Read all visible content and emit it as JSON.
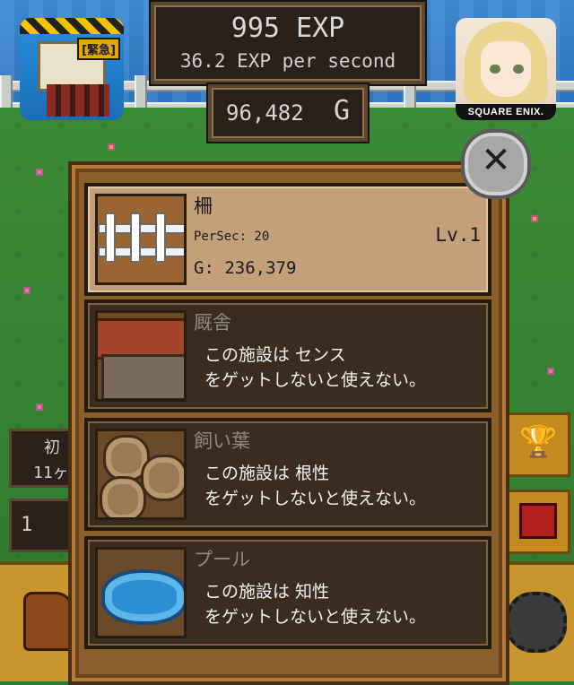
{
  "hud": {
    "exp_value": "995 EXP",
    "exp_rate": "36.2 EXP per second",
    "gold_value": "96,482",
    "gold_unit": "G"
  },
  "ads": {
    "left_badge": "[緊急]",
    "right_brand": "SQUARE ENIX."
  },
  "background_hints": {
    "left_label_top": "初",
    "left_label_bottom": "11ヶ",
    "left_counter": "1"
  },
  "modal": {
    "items": [
      {
        "name": "柵",
        "per_sec": "PerSec: 20",
        "level": "Lv.1",
        "cost": "G: 236,379",
        "icon": "fence-icon",
        "state": "unlocked"
      },
      {
        "name": "厩舎",
        "desc": "この施設は センス\nをゲットしないと使えない。",
        "icon": "barn-icon",
        "state": "locked"
      },
      {
        "name": "飼い葉",
        "desc": "この施設は 根性\nをゲットしないと使えない。",
        "icon": "hay-icon",
        "state": "locked"
      },
      {
        "name": "プール",
        "desc": "この施設は 知性\nをゲットしないと使えない。",
        "icon": "pool-icon",
        "state": "locked"
      }
    ]
  },
  "close_button": {
    "label": "✕",
    "icon": "close-icon"
  },
  "colors": {
    "panel_dark": "#2b2118",
    "modal_brown": "#8d5f2c",
    "unlocked_row": "#c4a07a",
    "locked_row": "#3a2c1e"
  }
}
